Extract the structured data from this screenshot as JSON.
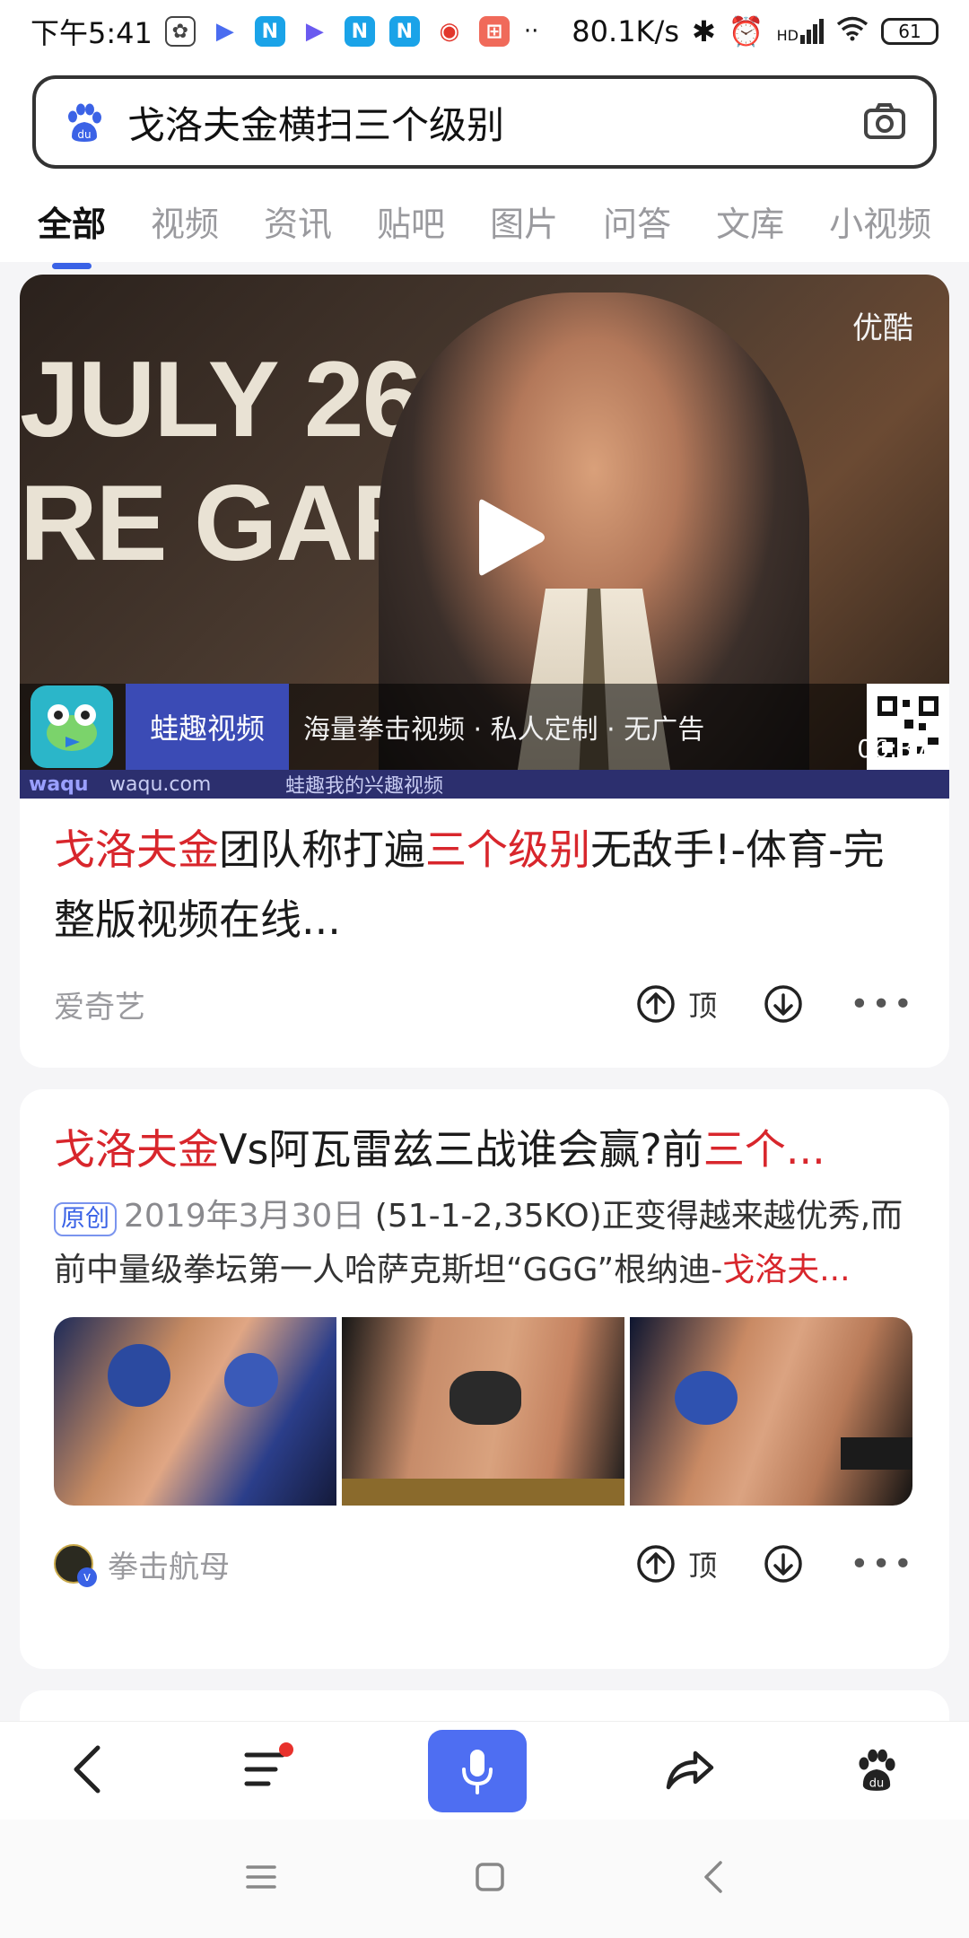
{
  "status_bar": {
    "time": "下午5:41",
    "net_speed": "80.1K/s",
    "network_label": "HD",
    "battery": "61"
  },
  "search": {
    "query": "戈洛夫金横扫三个级别"
  },
  "tabs": [
    "全部",
    "视频",
    "资讯",
    "贴吧",
    "图片",
    "问答",
    "文库",
    "小视频"
  ],
  "result1": {
    "video": {
      "bg_text_line1": "JULY 26",
      "bg_text_line2": "RE GARDE",
      "watermark": "优酷",
      "brand": "蛙趣视频",
      "slogan": "海量拳击视频 · 私人定制 · 无广告",
      "strip_logo": "waqu",
      "strip_url": "waqu.com",
      "strip_text": "蛙趣我的兴趣视频",
      "duration": "06:37"
    },
    "title_parts": {
      "p1": "戈洛夫金",
      "p2": "团队称打遍",
      "p3": "三个级别",
      "p4": "无敌手!-体育-完整版视频在线..."
    },
    "source": "爱奇艺",
    "up_label": "顶"
  },
  "result2": {
    "title_parts": {
      "p1": "戈洛夫金",
      "p2": "Vs阿瓦雷兹三战谁会赢?前",
      "p3": "三个..."
    },
    "badge": "原创",
    "date": "2019年3月30日",
    "desc_1": " (51-1-2,35KO)正变得越来越优秀,而前中量级拳坛第一人哈萨克斯坦“GGG”根纳迪-",
    "desc_hl": "戈洛夫...",
    "author": "拳击航母",
    "up_label": "顶"
  },
  "colors": {
    "accent": "#3a62e6",
    "highlight": "#d8262c",
    "mic": "#4e6ef2"
  }
}
